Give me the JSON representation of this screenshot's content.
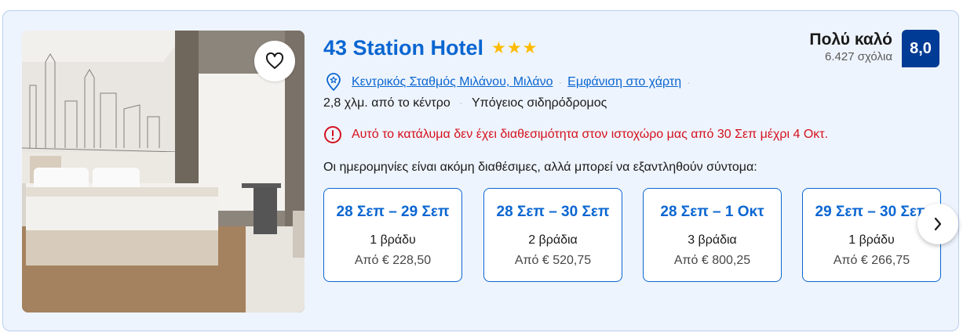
{
  "hotel": {
    "name": "43 Station Hotel",
    "stars": "★★★",
    "score_word": "Πολύ καλό",
    "review_count": "6.427 σχόλια",
    "score": "8,0"
  },
  "location": {
    "address": "Κεντρικός Σταθμός Μιλάνου, Μιλάνο",
    "map_link": "Εμφάνιση στο χάρτη",
    "distance": "2,8 χλμ. από το κέντρο",
    "separator": "·",
    "transit": "Υπόγειος σιδηρόδρομος"
  },
  "warning": {
    "text": "Αυτό το κατάλυμα δεν έχει διαθεσιμότητα στον ιστοχώρο μας από 30 Σεπ μέχρι 4 Οκτ."
  },
  "availability": {
    "text": "Οι ημερομηνίες είναι ακόμη διαθέσιμες, αλλά μπορεί να εξαντληθούν σύντομα:",
    "options": [
      {
        "range": "28 Σεπ – 29 Σεπ",
        "nights": "1 βράδυ",
        "price": "Από € 228,50"
      },
      {
        "range": "28 Σεπ – 30 Σεπ",
        "nights": "2 βράδια",
        "price": "Από € 520,75"
      },
      {
        "range": "28 Σεπ – 1 Οκτ",
        "nights": "3 βράδια",
        "price": "Από € 800,25"
      },
      {
        "range": "29 Σεπ – 30 Σεπ",
        "nights": "1 βράδυ",
        "price": "Από € 266,75"
      }
    ]
  },
  "colors": {
    "accent": "#0a66d1",
    "score_badge": "#003b95",
    "warning": "#d4111e",
    "stars": "#febb02",
    "card_bg": "#eef4fd"
  },
  "icons": {
    "favorite": "heart-icon",
    "location": "map-pin-icon",
    "warning": "alert-circle-icon",
    "next": "chevron-right-icon"
  }
}
